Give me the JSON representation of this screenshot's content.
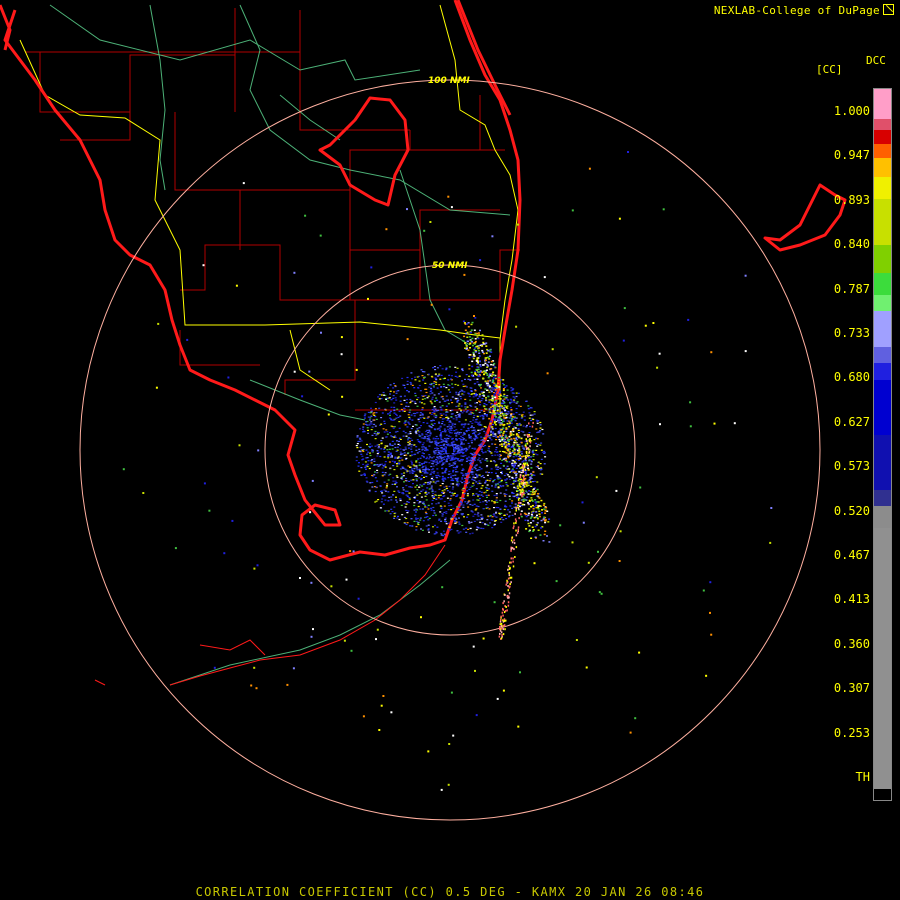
{
  "header": {
    "credit": "NEXLAB-College of DuPage"
  },
  "footer": {
    "caption": "CORRELATION COEFFICIENT (CC) 0.5 DEG - KAMX 20 JAN 26 08:46"
  },
  "map": {
    "radar_site": "KAMX",
    "range_rings": [
      {
        "label": "50 NMI"
      },
      {
        "label": "100 NMI"
      }
    ]
  },
  "legend": {
    "units": "[CC]",
    "product_code": "DCC",
    "labels": [
      "1.000",
      "0.947",
      "0.893",
      "0.840",
      "0.787",
      "0.733",
      "0.680",
      "0.627",
      "0.573",
      "0.520",
      "0.467",
      "0.413",
      "0.360",
      "0.307",
      "0.253",
      "TH"
    ],
    "color_stops": [
      "#ff9ec8",
      "#e0506a",
      "#d80000",
      "#ff6000",
      "#ffc000",
      "#f0f000",
      "#c8e000",
      "#80d000",
      "#3cdc3c",
      "#70f070",
      "#a0a0ff",
      "#6060e0",
      "#2020e0",
      "#0000d0",
      "#1010b0",
      "#303090",
      "#8c8c8c",
      "#909090",
      "#000000"
    ]
  },
  "colors": {
    "coastline": "#ff1a1a",
    "county_lines": "#b00000",
    "highways": "#ffff00",
    "minor_roads": "#5ad08c",
    "range_ring": "#ffb0a0",
    "label_text": "#ffff00"
  }
}
